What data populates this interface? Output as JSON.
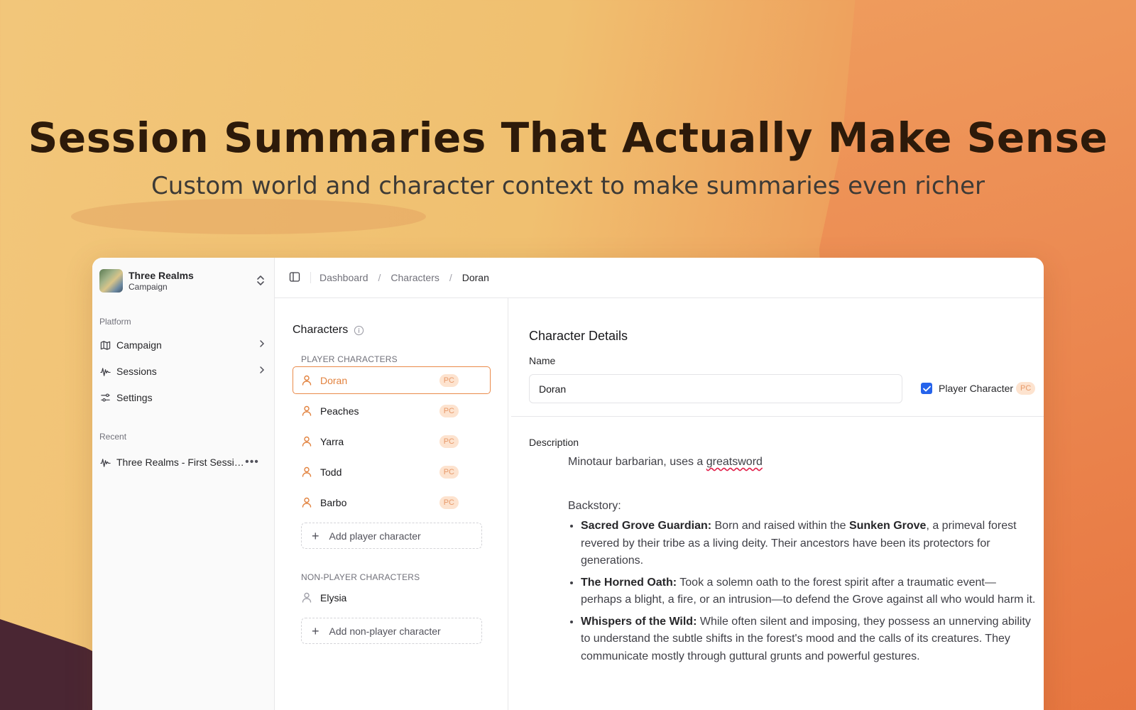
{
  "hero": {
    "title": "Session Summaries That Actually Make Sense",
    "subtitle": "Custom world and character context to make summaries even richer"
  },
  "sidebar": {
    "workspace_name": "Three Realms",
    "workspace_type": "Campaign",
    "platform_label": "Platform",
    "nav": [
      {
        "label": "Campaign",
        "icon": "map-icon"
      },
      {
        "label": "Sessions",
        "icon": "audio-wave-icon"
      },
      {
        "label": "Settings",
        "icon": "sliders-icon"
      }
    ],
    "recent_label": "Recent",
    "recent": [
      {
        "label": "Three Realms - First Session",
        "icon": "audio-wave-icon"
      }
    ]
  },
  "breadcrumb": [
    "Dashboard",
    "Characters",
    "Doran"
  ],
  "characters": {
    "title": "Characters",
    "pc_section_label": "PLAYER CHARACTERS",
    "pcs": [
      {
        "name": "Doran",
        "badge": "PC",
        "active": true
      },
      {
        "name": "Peaches",
        "badge": "PC"
      },
      {
        "name": "Yarra",
        "badge": "PC"
      },
      {
        "name": "Todd",
        "badge": "PC"
      },
      {
        "name": "Barbo",
        "badge": "PC"
      }
    ],
    "add_pc_label": "Add player character",
    "npc_section_label": "NON-PLAYER CHARACTERS",
    "npcs": [
      {
        "name": "Elysia"
      }
    ],
    "add_npc_label": "Add non-player character"
  },
  "details": {
    "title": "Character Details",
    "name_label": "Name",
    "name_value": "Doran",
    "pc_checkbox_label": "Player Character",
    "pc_checked": true,
    "pc_badge": "PC",
    "description_label": "Description",
    "description_intro": "Minotaur barbarian, uses a ",
    "description_intro_word": "greatsword",
    "backstory_label": "Backstory:",
    "backstory": [
      {
        "title": "Sacred Grove Guardian:",
        "text_before": " Born and raised within the ",
        "emph": "Sunken Grove",
        "text_after": ", a primeval forest revered by their tribe as a living deity. Their ancestors have been its protectors for generations."
      },
      {
        "title": "The Horned Oath:",
        "text_before": " Took a solemn oath to the forest spirit after a traumatic event—perhaps a blight, a fire, or an intrusion—to defend the Grove against all who would harm it.",
        "emph": "",
        "text_after": ""
      },
      {
        "title": "Whispers of the Wild:",
        "text_before": " While often silent and imposing, they possess an unnerving ability to understand the subtle shifts in the forest's mood and the calls of its creatures. They communicate mostly through guttural grunts and powerful gestures.",
        "emph": "",
        "text_after": ""
      }
    ]
  },
  "colors": {
    "accent": "#e2823e",
    "badge_bg": "#fde3cf",
    "checkbox": "#2563eb"
  }
}
